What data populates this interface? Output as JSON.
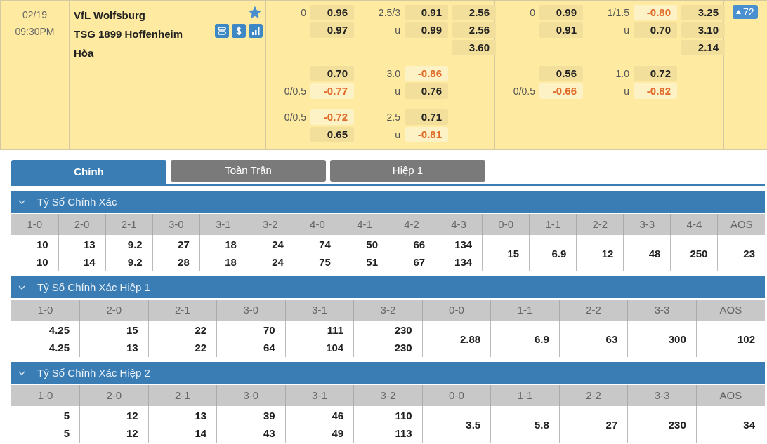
{
  "match": {
    "date": "02/19",
    "time": "09:30PM",
    "home": "VfL Wolfsburg",
    "away": "TSG 1899 Hoffenheim",
    "draw": "Hòa",
    "favorite": true,
    "more_count": "72"
  },
  "markets": [
    {
      "groups": [
        {
          "handicap": [
            {
              "line": "0",
              "odds": "0.96",
              "negative": false
            },
            {
              "odds": "0.97",
              "negative": false
            }
          ],
          "over_under": [
            {
              "line": "2.5/3",
              "odds": "0.91",
              "negative": false
            },
            {
              "line": "u",
              "odds": "0.99",
              "negative": false
            }
          ],
          "x12": [
            {
              "odds": "2.56",
              "negative": false
            },
            {
              "odds": "2.56",
              "negative": false
            },
            {
              "odds": "3.60",
              "negative": false
            }
          ]
        },
        {
          "handicap": [
            {
              "odds": "0.70",
              "negative": false
            },
            {
              "line": "0/0.5",
              "odds": "-0.77",
              "negative": true
            }
          ],
          "over_under": [
            {
              "line": "3.0",
              "odds": "-0.86",
              "negative": true
            },
            {
              "line": "u",
              "odds": "0.76",
              "negative": false
            }
          ]
        },
        {
          "handicap": [
            {
              "line": "0/0.5",
              "odds": "-0.72",
              "negative": true
            },
            {
              "odds": "0.65",
              "negative": false
            }
          ],
          "over_under": [
            {
              "line": "2.5",
              "odds": "0.71",
              "negative": false
            },
            {
              "line": "u",
              "odds": "-0.81",
              "negative": true
            }
          ]
        }
      ]
    },
    {
      "groups": [
        {
          "handicap": [
            {
              "line": "0",
              "odds": "0.99",
              "negative": false
            },
            {
              "odds": "0.91",
              "negative": false
            }
          ],
          "over_under": [
            {
              "line": "1/1.5",
              "odds": "-0.80",
              "negative": true
            },
            {
              "line": "u",
              "odds": "0.70",
              "negative": false
            }
          ],
          "x12": [
            {
              "odds": "3.25",
              "negative": false
            },
            {
              "odds": "3.10",
              "negative": false
            },
            {
              "odds": "2.14",
              "negative": false
            }
          ]
        },
        {
          "handicap": [
            {
              "odds": "0.56",
              "negative": false
            },
            {
              "line": "0/0.5",
              "odds": "-0.66",
              "negative": true
            }
          ],
          "over_under": [
            {
              "line": "1.0",
              "odds": "0.72",
              "negative": false
            },
            {
              "line": "u",
              "odds": "-0.82",
              "negative": true
            }
          ]
        }
      ]
    }
  ],
  "tabs": [
    {
      "label": "Chính",
      "selected": true
    },
    {
      "label": "Toàn Trận",
      "selected": false
    },
    {
      "label": "Hiệp 1",
      "selected": false
    }
  ],
  "sections": [
    {
      "title": "Tỷ Số Chính Xác",
      "expanded": true,
      "columns": [
        {
          "label": "1-0",
          "values": [
            "10",
            "10"
          ]
        },
        {
          "label": "2-0",
          "values": [
            "13",
            "14"
          ]
        },
        {
          "label": "2-1",
          "values": [
            "9.2",
            "9.2"
          ]
        },
        {
          "label": "3-0",
          "values": [
            "27",
            "28"
          ]
        },
        {
          "label": "3-1",
          "values": [
            "18",
            "18"
          ]
        },
        {
          "label": "3-2",
          "values": [
            "24",
            "24"
          ]
        },
        {
          "label": "4-0",
          "values": [
            "74",
            "75"
          ]
        },
        {
          "label": "4-1",
          "values": [
            "50",
            "51"
          ]
        },
        {
          "label": "4-2",
          "values": [
            "66",
            "67"
          ]
        },
        {
          "label": "4-3",
          "values": [
            "134",
            "134"
          ]
        },
        {
          "label": "0-0",
          "values": [
            "15"
          ]
        },
        {
          "label": "1-1",
          "values": [
            "6.9"
          ]
        },
        {
          "label": "2-2",
          "values": [
            "12"
          ]
        },
        {
          "label": "3-3",
          "values": [
            "48"
          ]
        },
        {
          "label": "4-4",
          "values": [
            "250"
          ]
        },
        {
          "label": "AOS",
          "values": [
            "23"
          ]
        }
      ]
    },
    {
      "title": "Tỷ Số Chính Xác Hiệp 1",
      "expanded": true,
      "columns": [
        {
          "label": "1-0",
          "values": [
            "4.25",
            "4.25"
          ]
        },
        {
          "label": "2-0",
          "values": [
            "15",
            "13"
          ]
        },
        {
          "label": "2-1",
          "values": [
            "22",
            "22"
          ]
        },
        {
          "label": "3-0",
          "values": [
            "70",
            "64"
          ]
        },
        {
          "label": "3-1",
          "values": [
            "111",
            "104"
          ]
        },
        {
          "label": "3-2",
          "values": [
            "230",
            "230"
          ]
        },
        {
          "label": "0-0",
          "values": [
            "2.88"
          ]
        },
        {
          "label": "1-1",
          "values": [
            "6.9"
          ]
        },
        {
          "label": "2-2",
          "values": [
            "63"
          ]
        },
        {
          "label": "3-3",
          "values": [
            "300"
          ]
        },
        {
          "label": "AOS",
          "values": [
            "102"
          ]
        }
      ]
    },
    {
      "title": "Tỷ Số Chính Xác Hiệp 2",
      "expanded": true,
      "columns": [
        {
          "label": "1-0",
          "values": [
            "5",
            "5"
          ]
        },
        {
          "label": "2-0",
          "values": [
            "12",
            "12"
          ]
        },
        {
          "label": "2-1",
          "values": [
            "13",
            "14"
          ]
        },
        {
          "label": "3-0",
          "values": [
            "39",
            "43"
          ]
        },
        {
          "label": "3-1",
          "values": [
            "46",
            "49"
          ]
        },
        {
          "label": "3-2",
          "values": [
            "110",
            "113"
          ]
        },
        {
          "label": "0-0",
          "values": [
            "3.5"
          ]
        },
        {
          "label": "1-1",
          "values": [
            "5.8"
          ]
        },
        {
          "label": "2-2",
          "values": [
            "27"
          ]
        },
        {
          "label": "3-3",
          "values": [
            "230"
          ]
        },
        {
          "label": "AOS",
          "values": [
            "34"
          ]
        }
      ]
    }
  ]
}
